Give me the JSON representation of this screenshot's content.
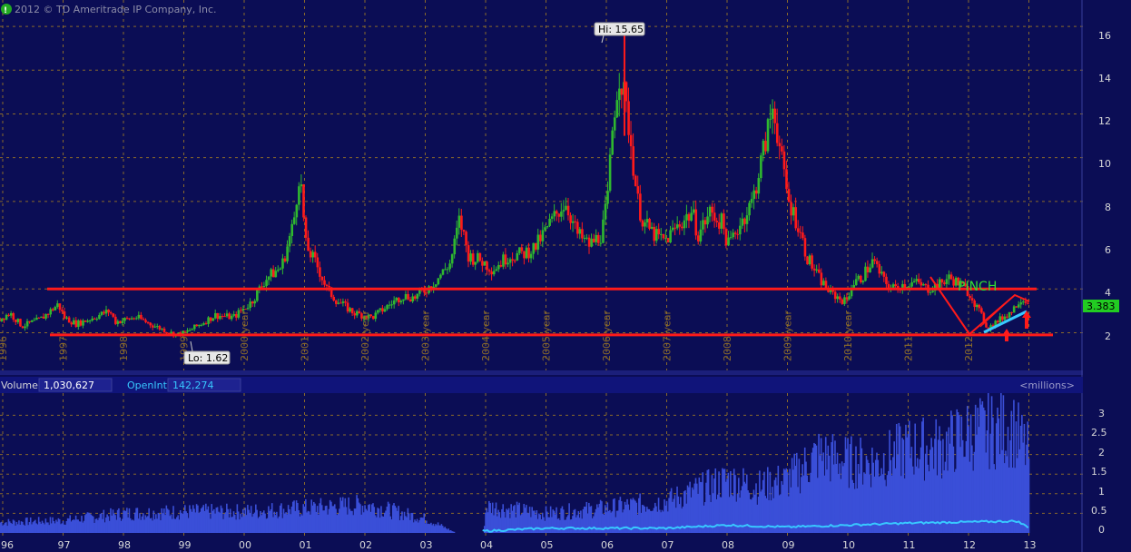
{
  "copyright": "2012 © TD Ameritrade IP Company, Inc.",
  "colors": {
    "background": "#0b0d55",
    "grid": "#8a6a2a",
    "up_candle": "#2fb82f",
    "down_candle": "#ff1a1a",
    "support_resistance": "#ff1a1a",
    "volume_bar": "#3a4fd8",
    "open_interest": "#38c8ff",
    "trend_line": "#38c8ff",
    "pinch_text": "#33dd33",
    "price_badge": "#22cc22"
  },
  "price_panel": {
    "hi_label": "Hi: 15.65",
    "lo_label": "Lo: 1.62",
    "last_price": "3.383",
    "annotation": "PINCH",
    "y_ticks": [
      "16",
      "14",
      "12",
      "10",
      "8",
      "6",
      "4",
      "2"
    ],
    "year_labels": [
      "1996",
      "1997",
      "1998",
      "1999",
      "2000 year",
      "2001",
      "2002 year",
      "2003 year",
      "2004 year",
      "2005 year",
      "2006 year",
      "2007 year",
      "2008",
      "2009 year",
      "2010 year",
      "2011",
      "2012"
    ]
  },
  "volume_panel": {
    "volume_label": "Volume",
    "volume_value": "1,030,627",
    "oi_label": "OpenInterest",
    "oi_value": "142,274",
    "unit_label": "<millions>",
    "y_ticks": [
      "3",
      "2.5",
      "2",
      "1.5",
      "1",
      "0.5",
      "0"
    ]
  },
  "x_axis": {
    "labels": [
      "96",
      "97",
      "98",
      "99",
      "00",
      "01",
      "02",
      "03",
      "04",
      "05",
      "06",
      "07",
      "08",
      "09",
      "10",
      "11",
      "12",
      "13"
    ]
  },
  "chart_data": {
    "type": "candlestick",
    "resistance_level": 4.0,
    "support_level": 1.9,
    "price_ylim": [
      0.4,
      17.0
    ],
    "volume_ylim": [
      0,
      3.3
    ],
    "high": 15.65,
    "low": 1.62,
    "last": 3.383,
    "volume_keypoints": [
      [
        1996,
        0.3
      ],
      [
        1997,
        0.35
      ],
      [
        1998,
        0.55
      ],
      [
        1999,
        0.6
      ],
      [
        2000,
        0.6
      ],
      [
        2001,
        0.7
      ],
      [
        2002,
        0.8
      ],
      [
        2003,
        0.4
      ],
      [
        2003.5,
        0
      ],
      [
        2003.95,
        0
      ],
      [
        2004,
        0.75
      ],
      [
        2005,
        0.55
      ],
      [
        2006,
        0.7
      ],
      [
        2007,
        0.9
      ],
      [
        2008,
        1.5
      ],
      [
        2008.5,
        1.3
      ],
      [
        2009,
        1.5
      ],
      [
        2009.5,
        2.2
      ],
      [
        2010,
        2.0
      ],
      [
        2010.5,
        2.0
      ],
      [
        2011,
        2.4
      ],
      [
        2011.5,
        2.4
      ],
      [
        2012,
        2.8
      ],
      [
        2012.7,
        3.0
      ],
      [
        2013,
        2.2
      ]
    ],
    "open_interest_keypoints": [
      [
        2004,
        0.05
      ],
      [
        2005,
        0.12
      ],
      [
        2007,
        0.12
      ],
      [
        2008,
        0.2
      ],
      [
        2009,
        0.15
      ],
      [
        2010,
        0.2
      ],
      [
        2011,
        0.25
      ],
      [
        2012,
        0.28
      ],
      [
        2012.8,
        0.3
      ],
      [
        2013,
        0.14
      ]
    ],
    "price_keypoints": [
      [
        1995.85,
        2.5
      ],
      [
        1996.1,
        2.9
      ],
      [
        1996.3,
        2.3
      ],
      [
        1996.6,
        2.6
      ],
      [
        1996.9,
        3.3
      ],
      [
        1997.0,
        2.7
      ],
      [
        1997.2,
        2.4
      ],
      [
        1997.4,
        2.6
      ],
      [
        1997.75,
        3.0
      ],
      [
        1997.85,
        2.5
      ],
      [
        1998.2,
        2.7
      ],
      [
        1998.5,
        2.3
      ],
      [
        1998.85,
        1.9
      ],
      [
        1999.0,
        2.0
      ],
      [
        1999.2,
        2.3
      ],
      [
        1999.5,
        2.8
      ],
      [
        1999.8,
        2.7
      ],
      [
        2000.1,
        3.4
      ],
      [
        2000.35,
        4.5
      ],
      [
        2000.6,
        5.0
      ],
      [
        2000.8,
        7.0
      ],
      [
        2000.9,
        9.5
      ],
      [
        2001.0,
        6.0
      ],
      [
        2001.2,
        5.0
      ],
      [
        2001.35,
        4.0
      ],
      [
        2001.5,
        3.5
      ],
      [
        2001.8,
        2.9
      ],
      [
        2002.1,
        2.7
      ],
      [
        2002.4,
        3.3
      ],
      [
        2002.6,
        3.7
      ],
      [
        2002.8,
        3.6
      ],
      [
        2003.1,
        4.2
      ],
      [
        2003.4,
        5.2
      ],
      [
        2003.55,
        7.2
      ],
      [
        2003.7,
        5.5
      ],
      [
        2003.9,
        5.3
      ],
      [
        2004.1,
        4.9
      ],
      [
        2004.35,
        5.5
      ],
      [
        2004.6,
        5.6
      ],
      [
        2004.8,
        5.9
      ],
      [
        2005.05,
        7.0
      ],
      [
        2005.3,
        8.0
      ],
      [
        2005.5,
        6.5
      ],
      [
        2005.7,
        6.0
      ],
      [
        2005.9,
        6.5
      ],
      [
        2006.0,
        8.0
      ],
      [
        2006.1,
        12.0
      ],
      [
        2006.2,
        14.0
      ],
      [
        2006.35,
        11.5
      ],
      [
        2006.5,
        8.0
      ],
      [
        2006.6,
        7.0
      ],
      [
        2006.8,
        6.4
      ],
      [
        2006.95,
        6.2
      ],
      [
        2007.2,
        7.0
      ],
      [
        2007.4,
        7.5
      ],
      [
        2007.5,
        6.5
      ],
      [
        2007.7,
        7.5
      ],
      [
        2007.9,
        7.0
      ],
      [
        2008.0,
        6.0
      ],
      [
        2008.2,
        7.0
      ],
      [
        2008.4,
        8.0
      ],
      [
        2008.6,
        10.5
      ],
      [
        2008.75,
        12.5
      ],
      [
        2008.9,
        9.5
      ],
      [
        2009.0,
        8.0
      ],
      [
        2009.15,
        7.0
      ],
      [
        2009.3,
        5.5
      ],
      [
        2009.5,
        4.5
      ],
      [
        2009.7,
        3.8
      ],
      [
        2009.95,
        3.4
      ],
      [
        2010.05,
        4.2
      ],
      [
        2010.2,
        4.5
      ],
      [
        2010.4,
        5.3
      ],
      [
        2010.55,
        4.5
      ],
      [
        2010.7,
        4.0
      ],
      [
        2010.9,
        4.2
      ],
      [
        2011.1,
        4.3
      ],
      [
        2011.3,
        4.0
      ],
      [
        2011.5,
        4.2
      ],
      [
        2011.65,
        4.5
      ],
      [
        2011.8,
        4.3
      ],
      [
        2012.0,
        3.8
      ],
      [
        2012.15,
        3.0
      ],
      [
        2012.3,
        2.2
      ],
      [
        2012.5,
        2.6
      ],
      [
        2012.7,
        3.0
      ],
      [
        2012.85,
        3.6
      ],
      [
        2013.0,
        3.38
      ]
    ]
  }
}
